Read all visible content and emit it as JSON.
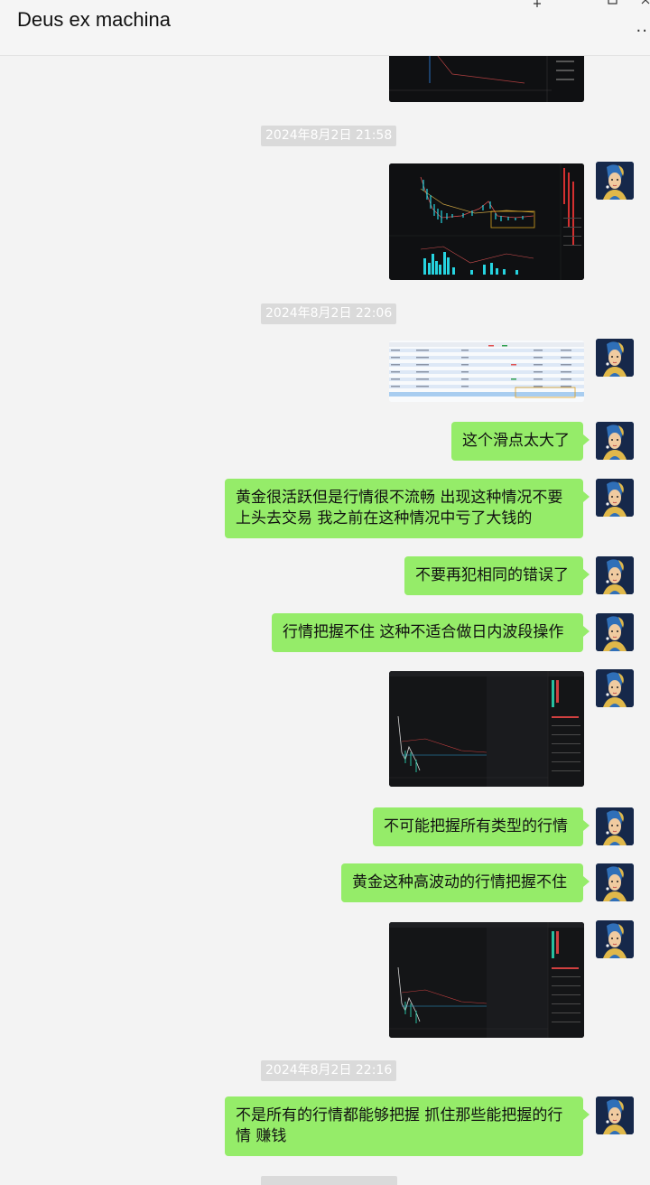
{
  "window": {
    "title": "Deus ex machina",
    "pin_icon": "pin-icon",
    "minimize_icon": "minimize-icon",
    "maximize_icon": "maximize-icon",
    "close_icon": "close-icon",
    "more_icon": "more-icon"
  },
  "timestamps": [
    "2024年8月2日 21:58",
    "2024年8月2日 22:06",
    "2024年8月2日 22:16"
  ],
  "messages": {
    "m1": "这个滑点太大了",
    "m2": "黄金很活跃但是行情很不流畅 出现这种情况不要上头去交易 我之前在这种情况中亏了大钱的",
    "m3": "不要再犯相同的错误了",
    "m4": "行情把握不住 这种不适合做日内波段操作",
    "m5": "不可能把握所有类型的行情",
    "m6": "黄金这种高波动的行情把握不住",
    "m7": "不是所有的行情都能够把握 抓住那些能把握的行情 赚钱"
  },
  "colors": {
    "bubble": "#95ec69",
    "background": "#f3f3f3",
    "chart_bg": "#0f1012",
    "candle_up": "#26d4e0"
  }
}
